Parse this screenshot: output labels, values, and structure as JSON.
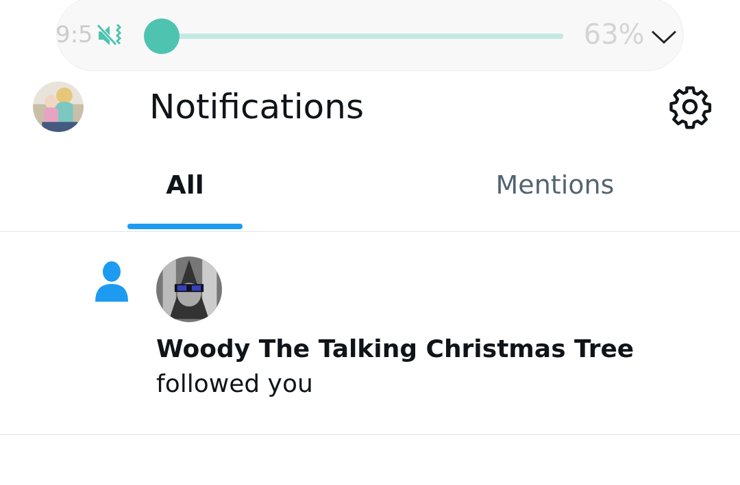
{
  "status_bar": {
    "time": "9:5",
    "battery": "63%"
  },
  "volume_panel": {
    "muted": true,
    "level": 0.0
  },
  "header": {
    "title": "Notifications"
  },
  "tabs": [
    {
      "label": "All",
      "selected": true
    },
    {
      "label": "Mentions",
      "selected": false
    }
  ],
  "notifications": [
    {
      "kind": "follow",
      "name": "Woody The Talking Christmas Tree",
      "action": "followed you"
    }
  ]
}
